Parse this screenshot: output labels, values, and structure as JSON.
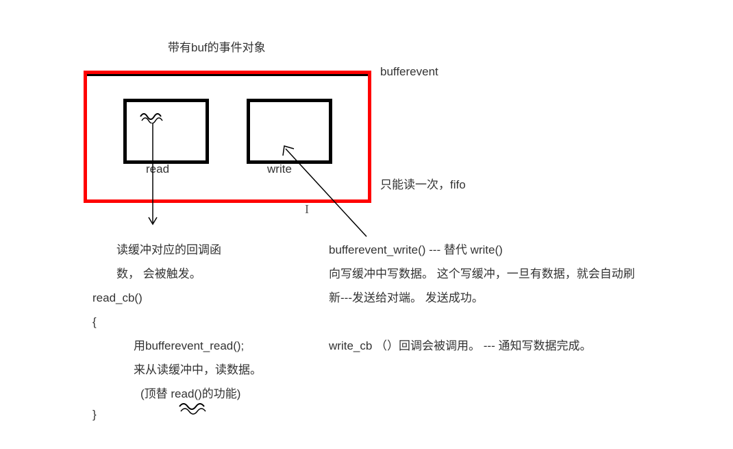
{
  "title": "带有buf的事件对象",
  "right_title": "bufferevent",
  "read_label": "read",
  "write_label": "write",
  "fifo_text": "只能读一次，fifo",
  "read_desc1": "读缓冲对应的回调函",
  "read_desc2": "数， 会被触发。",
  "read_cb": "read_cb()",
  "brace_open": "{",
  "read_body1": "用bufferevent_read();",
  "read_body2": "来从读缓冲中，读数据。",
  "read_body3": "(顶替 read()的功能)",
  "brace_close": "}",
  "write_desc1": "bufferevent_write()   --- 替代 write()",
  "write_desc2": "向写缓冲中写数据。 这个写缓冲，一旦有数据，就会自动刷",
  "write_desc3": "新---发送给对端。 发送成功。",
  "write_cb": "write_cb  （）回调会被调用。 --- 通知写数据完成。"
}
